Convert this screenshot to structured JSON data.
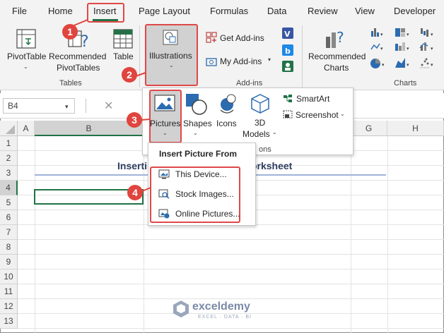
{
  "menubar": {
    "tabs": [
      "File",
      "Home",
      "Insert",
      "Page Layout",
      "Formulas",
      "Data",
      "Review",
      "View",
      "Developer"
    ]
  },
  "ribbon": {
    "pivot_table": "PivotTable",
    "recommended_pivot_line1": "Recommended",
    "recommended_pivot_line2": "PivotTables",
    "table": "Table",
    "illustrations": "Illustrations",
    "get_addins": "Get Add-ins",
    "my_addins": "My Add-ins",
    "recommended_charts_line1": "Recommended",
    "recommended_charts_line2": "Charts",
    "groups": {
      "tables": "Tables",
      "addins": "Add-ins",
      "charts": "Charts"
    }
  },
  "formula_bar": {
    "name_box": "B4"
  },
  "grid": {
    "columns": [
      "A",
      "B",
      "H"
    ],
    "col_g": "G",
    "rows": [
      "1",
      "2",
      "3",
      "4",
      "5",
      "6",
      "7",
      "8",
      "9",
      "10",
      "11",
      "12",
      "13"
    ],
    "title_left": "Inserti",
    "title_right": "Worksheet"
  },
  "illustrations_panel": {
    "pictures": "Pictures",
    "shapes": "Shapes",
    "icons": "Icons",
    "models_line1": "3D",
    "models_line2": "Models",
    "smartart": "SmartArt",
    "screenshot": "Screenshot",
    "group_label_partial": "ons"
  },
  "picture_menu": {
    "heading": "Insert Picture From",
    "items": [
      "This Device...",
      "Stock Images...",
      "Online Pictures..."
    ]
  },
  "callouts": [
    "1",
    "2",
    "3",
    "4"
  ],
  "watermark": {
    "name": "exceldemy",
    "tagline": "EXCEL · DATA · BI"
  },
  "colors": {
    "accent": "#217346",
    "callout": "#e0443e"
  }
}
